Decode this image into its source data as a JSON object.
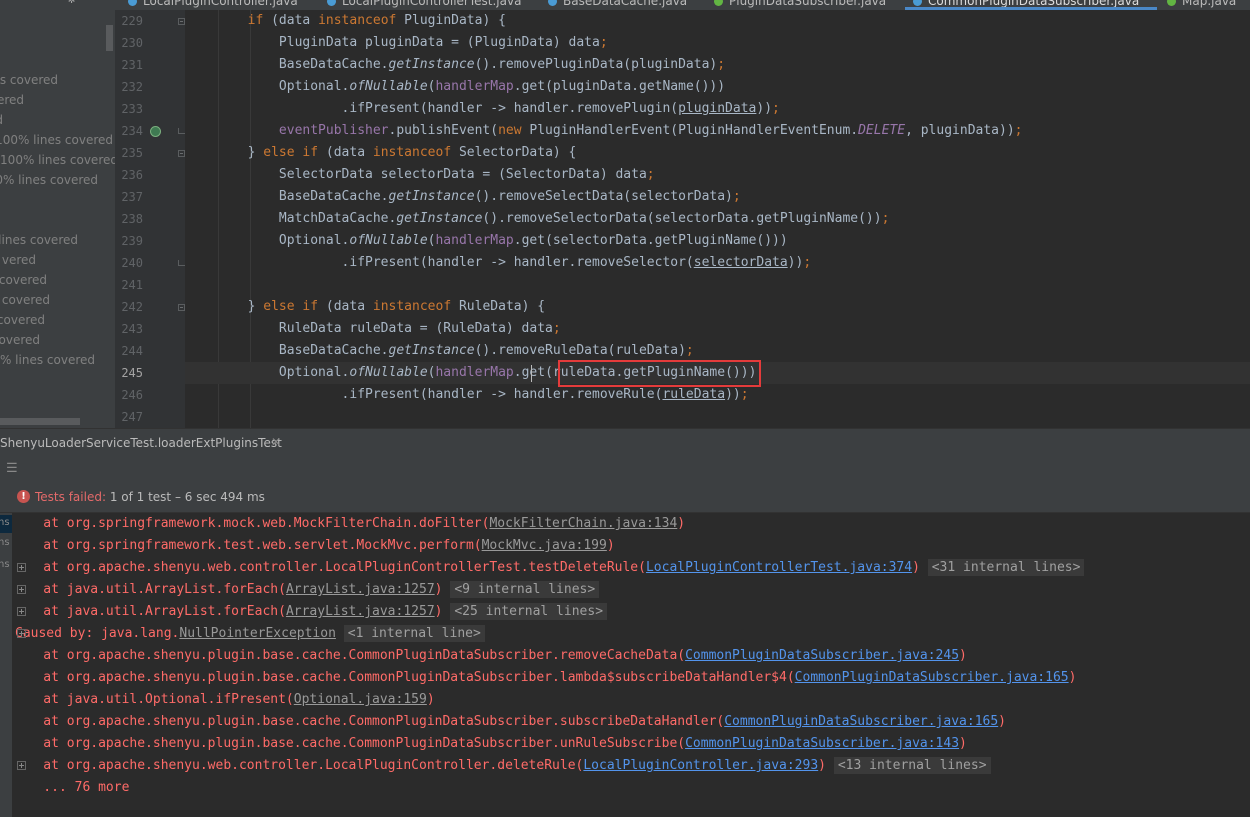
{
  "tabs": [
    {
      "label": "LocalPluginController.java",
      "color": "#4a9bd4"
    },
    {
      "label": "LocalPluginControllerTest.java",
      "color": "#4a9bd4"
    },
    {
      "label": "BaseDataCache.java",
      "color": "#4a9bd4"
    },
    {
      "label": "PluginDataSubscriber.java",
      "color": "#62b543"
    },
    {
      "label": "CommonPluginDataSubscriber.java",
      "color": "#4a9bd4",
      "active": true
    },
    {
      "label": "Map.java",
      "color": "#62b543"
    }
  ],
  "coverage": [
    "es covered",
    "ered",
    "d",
    "100% lines covered",
    ", 100% lines covered",
    "0% lines covered",
    "lines covered",
    "vered",
    "covered",
    "covered",
    "covered",
    "overed",
    "0% lines covered"
  ],
  "editor": {
    "line_numbers": [
      "229",
      "230",
      "231",
      "232",
      "233",
      "234",
      "235",
      "236",
      "237",
      "238",
      "239",
      "240",
      "241",
      "242",
      "243",
      "244",
      "245",
      "246",
      "247"
    ],
    "current_line": "245",
    "code": {
      "l229": {
        "a": "if",
        "b": " (data ",
        "c": "instanceof",
        "d": " PluginData) {"
      },
      "l230": {
        "a": "PluginData pluginData = (PluginData) data",
        "b": ";"
      },
      "l231": {
        "a": "BaseDataCache.",
        "b": "getInstance",
        "c": "().removePluginData(pluginData)",
        "d": ";"
      },
      "l232": {
        "a": "Optional.",
        "b": "ofNullable",
        "c": "(",
        "d": "handlerMap",
        "e": ".get(pluginData.getName()))"
      },
      "l233": {
        "a": ".ifPresent(handler -> handler.removePlugin(",
        "b": "pluginData",
        "c": "))",
        "d": ";"
      },
      "l234": {
        "a": "eventPublisher",
        "b": ".publishEvent(",
        "c": "new",
        "d": " PluginHandlerEvent(PluginHandlerEventEnum.",
        "e": "DELETE",
        "f": ", pluginData))",
        "g": ";"
      },
      "l235": {
        "a": "} ",
        "b": "else if",
        "c": " (data ",
        "d": "instanceof",
        "e": " SelectorData) {"
      },
      "l236": {
        "a": "SelectorData selectorData = (SelectorData) data",
        "b": ";"
      },
      "l237": {
        "a": "BaseDataCache.",
        "b": "getInstance",
        "c": "().removeSelectData(selectorData)",
        "d": ";"
      },
      "l238": {
        "a": "MatchDataCache.",
        "b": "getInstance",
        "c": "().removeSelectorData(selectorData.getPluginName())",
        "d": ";"
      },
      "l239": {
        "a": "Optional.",
        "b": "ofNullable",
        "c": "(",
        "d": "handlerMap",
        "e": ".get(selectorData.getPluginName()))"
      },
      "l240": {
        "a": ".ifPresent(handler -> handler.removeSelector(",
        "b": "selectorData",
        "c": "))",
        "d": ";"
      },
      "l242": {
        "a": "} ",
        "b": "else if",
        "c": " (data ",
        "d": "instanceof",
        "e": " RuleData) {"
      },
      "l243": {
        "a": "RuleData ruleData = (RuleData) data",
        "b": ";"
      },
      "l244": {
        "a": "BaseDataCache.",
        "b": "getInstance",
        "c": "().removeRuleData(ruleData)",
        "d": ";"
      },
      "l245": {
        "a": "Optional.",
        "b": "ofNullable",
        "c": "(",
        "d": "handlerMap",
        "e": ".get(ruleData.getPluginName()))"
      },
      "l246": {
        "a": ".ifPresent(handler -> handler.removeRule(",
        "b": "ruleData",
        "c": "))",
        "d": ";"
      }
    }
  },
  "run": {
    "title": "ShenyuLoaderServiceTest.loaderExtPluginsTest",
    "status_failed": "Tests failed:",
    "status_rest": " 1 of 1 test – 6 sec 494 ms",
    "tree_items": [
      "ns",
      "ns",
      "ns"
    ]
  },
  "console": {
    "c1": {
      "pre": "    at org.springframework.mock.web.MockFilterChain.doFilter(",
      "link": "MockFilterChain.java:134",
      "post": ")"
    },
    "c2": {
      "pre": "    at org.springframework.test.web.servlet.MockMvc.perform(",
      "link": "MockMvc.java:199",
      "post": ")"
    },
    "c3": {
      "pre": "    at org.apache.shenyu.web.controller.LocalPluginControllerTest.testDeleteRule(",
      "link": "LocalPluginControllerTest.java:374",
      "post": ") ",
      "chip": "<31 internal lines>"
    },
    "c4": {
      "pre": "    at java.util.ArrayList.forEach(",
      "link": "ArrayList.java:1257",
      "post": ") ",
      "chip": "<9 internal lines>"
    },
    "c5": {
      "pre": "    at java.util.ArrayList.forEach(",
      "link": "ArrayList.java:1257",
      "post": ") ",
      "chip": "<25 internal lines>"
    },
    "c6": {
      "pre": "Caused by: java.lang.",
      "link": "NullPointerException",
      "post": " ",
      "chip": "<1 internal line>"
    },
    "c7": {
      "pre": "    at org.apache.shenyu.plugin.base.cache.CommonPluginDataSubscriber.removeCacheData(",
      "link": "CommonPluginDataSubscriber.java:245",
      "post": ")"
    },
    "c8": {
      "pre": "    at org.apache.shenyu.plugin.base.cache.CommonPluginDataSubscriber.lambda$subscribeDataHandler$4(",
      "link": "CommonPluginDataSubscriber.java:165",
      "post": ")"
    },
    "c9": {
      "pre": "    at java.util.Optional.ifPresent(",
      "link": "Optional.java:159",
      "post": ")"
    },
    "c10": {
      "pre": "    at org.apache.shenyu.plugin.base.cache.CommonPluginDataSubscriber.subscribeDataHandler(",
      "link": "CommonPluginDataSubscriber.java:165",
      "post": ")"
    },
    "c11": {
      "pre": "    at org.apache.shenyu.plugin.base.cache.CommonPluginDataSubscriber.unRuleSubscribe(",
      "link": "CommonPluginDataSubscriber.java:143",
      "post": ")"
    },
    "c12": {
      "pre": "    at org.apache.shenyu.web.controller.LocalPluginController.deleteRule(",
      "link": "LocalPluginController.java:293",
      "post": ") ",
      "chip": "<13 internal lines>"
    },
    "c13": {
      "pre": "    ... 76 more"
    }
  }
}
